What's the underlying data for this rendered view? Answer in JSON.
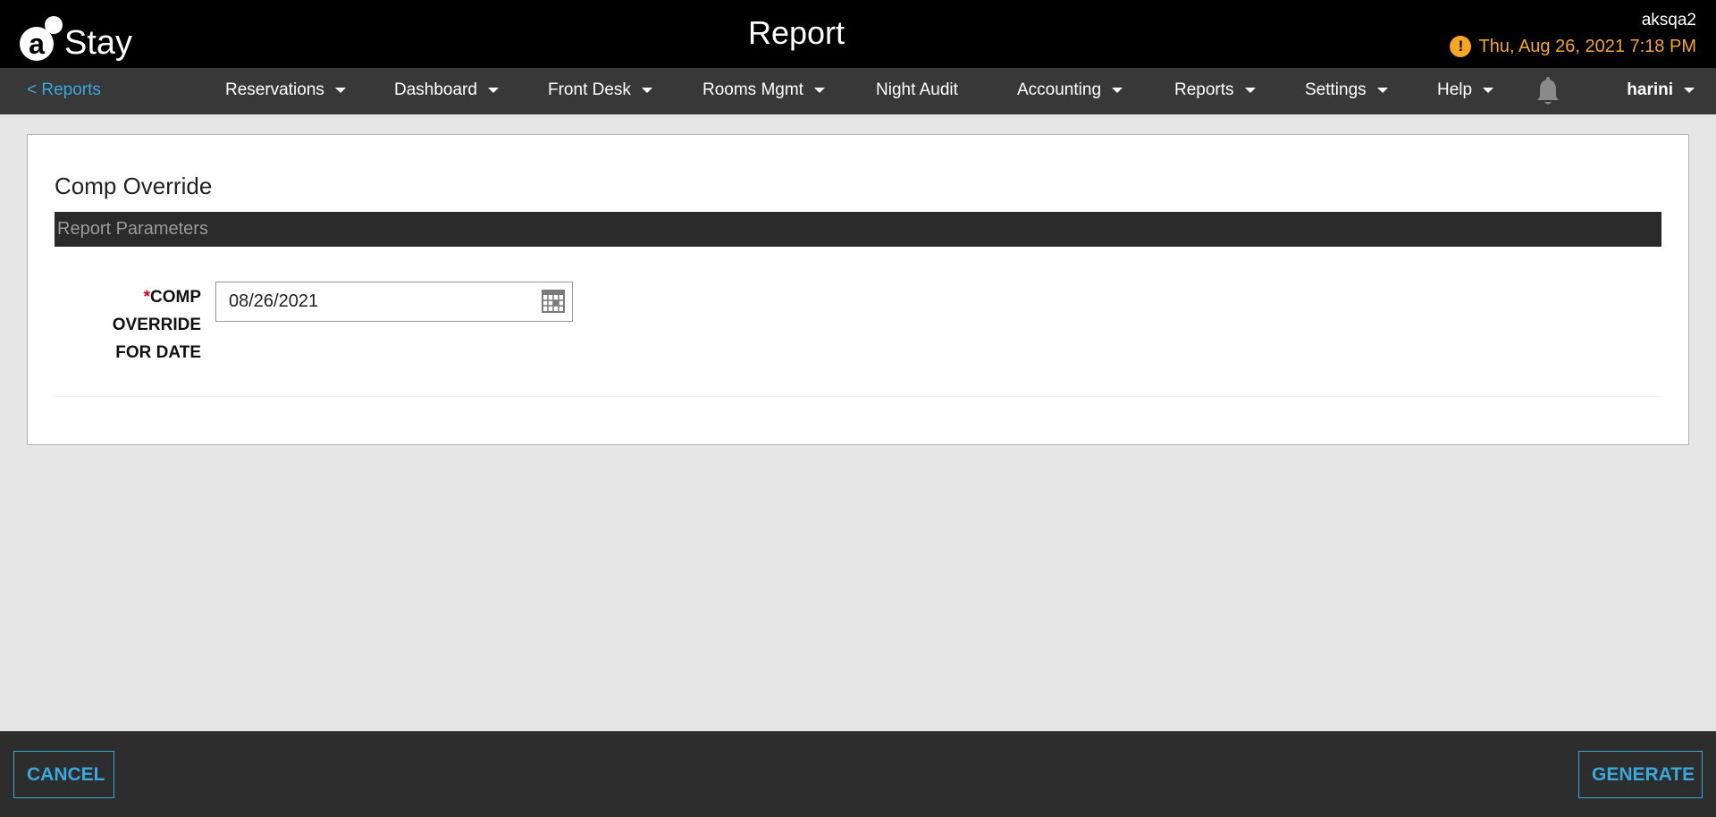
{
  "header": {
    "logo_letter": "a",
    "logo_text": "Stay",
    "title": "Report",
    "user_code": "aksqa2",
    "datetime": "Thu, Aug 26, 2021 7:18 PM",
    "warning_icon": "exclamation-circle-icon",
    "datetime_color": "#f5a623"
  },
  "nav": {
    "back_label": "< Reports",
    "items": [
      {
        "label": "Reservations",
        "dropdown": true
      },
      {
        "label": "Dashboard",
        "dropdown": true
      },
      {
        "label": "Front Desk",
        "dropdown": true
      },
      {
        "label": "Rooms Mgmt",
        "dropdown": true
      },
      {
        "label": "Night Audit",
        "dropdown": false
      },
      {
        "label": "Accounting",
        "dropdown": true
      },
      {
        "label": "Reports",
        "dropdown": true
      },
      {
        "label": "Settings",
        "dropdown": true
      },
      {
        "label": "Help",
        "dropdown": true
      }
    ],
    "bell_icon": "bell-icon",
    "user_name": "harini"
  },
  "report": {
    "title": "Comp Override",
    "params_header": "Report Parameters",
    "field_required_mark": "*",
    "field_label": "COMP OVERRIDE FOR DATE",
    "date_value": "08/26/2021",
    "calendar_icon": "calendar-icon"
  },
  "footer": {
    "cancel_label": "CANCEL",
    "generate_label": "GENERATE",
    "accent_color": "#3aa8dc"
  }
}
